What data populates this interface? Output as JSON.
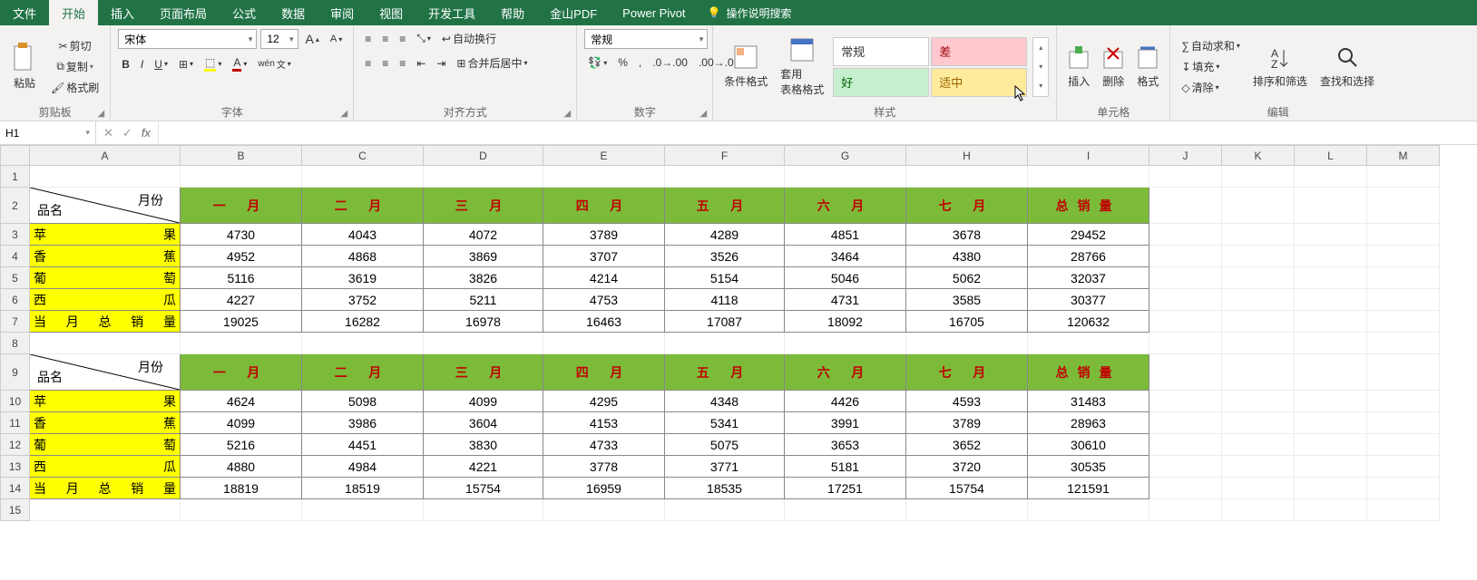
{
  "menu": {
    "tabs": [
      "文件",
      "开始",
      "插入",
      "页面布局",
      "公式",
      "数据",
      "审阅",
      "视图",
      "开发工具",
      "帮助",
      "金山PDF",
      "Power Pivot"
    ],
    "active": 1,
    "tell_me": "操作说明搜索"
  },
  "ribbon": {
    "clipboard": {
      "paste": "粘贴",
      "cut": "剪切",
      "copy": "复制",
      "format_painter": "格式刷",
      "label": "剪贴板"
    },
    "font": {
      "name": "宋体",
      "size": "12",
      "label": "字体"
    },
    "align": {
      "wrap": "自动换行",
      "merge": "合并后居中",
      "label": "对齐方式"
    },
    "number": {
      "format": "常规",
      "label": "数字"
    },
    "styles": {
      "cond": "条件格式",
      "table": "套用\n表格格式",
      "normal": "常规",
      "bad": "差",
      "good": "好",
      "neutral": "适中",
      "label": "样式"
    },
    "cells": {
      "insert": "插入",
      "delete": "删除",
      "format": "格式",
      "label": "单元格"
    },
    "editing": {
      "sum": "自动求和",
      "fill": "填充",
      "clear": "清除",
      "sort": "排序和筛选",
      "find": "查找和选择",
      "label": "编辑"
    }
  },
  "formula_bar": {
    "name": "H1",
    "value": ""
  },
  "columns": [
    "A",
    "B",
    "C",
    "D",
    "E",
    "F",
    "G",
    "H",
    "I",
    "J",
    "K",
    "L",
    "M"
  ],
  "diag": {
    "tr": "月份",
    "bl": "品名"
  },
  "months": [
    "一 月",
    "二 月",
    "三 月",
    "四 月",
    "五 月",
    "六 月",
    "七 月",
    "总销量"
  ],
  "block1": {
    "rows": [
      {
        "name": "苹果",
        "v": [
          4730,
          4043,
          4072,
          3789,
          4289,
          4851,
          3678,
          29452
        ]
      },
      {
        "name": "香蕉",
        "v": [
          4952,
          4868,
          3869,
          3707,
          3526,
          3464,
          4380,
          28766
        ]
      },
      {
        "name": "葡萄",
        "v": [
          5116,
          3619,
          3826,
          4214,
          5154,
          5046,
          5062,
          32037
        ]
      },
      {
        "name": "西瓜",
        "v": [
          4227,
          3752,
          5211,
          4753,
          4118,
          4731,
          3585,
          30377
        ]
      },
      {
        "name": "当月总销量",
        "v": [
          19025,
          16282,
          16978,
          16463,
          17087,
          18092,
          16705,
          120632
        ]
      }
    ]
  },
  "block2": {
    "rows": [
      {
        "name": "苹果",
        "v": [
          4624,
          5098,
          4099,
          4295,
          4348,
          4426,
          4593,
          31483
        ]
      },
      {
        "name": "香蕉",
        "v": [
          4099,
          3986,
          3604,
          4153,
          5341,
          3991,
          3789,
          28963
        ]
      },
      {
        "name": "葡萄",
        "v": [
          5216,
          4451,
          3830,
          4733,
          5075,
          3653,
          3652,
          30610
        ]
      },
      {
        "name": "西瓜",
        "v": [
          4880,
          4984,
          4221,
          3778,
          3771,
          5181,
          3720,
          30535
        ]
      },
      {
        "name": "当月总销量",
        "v": [
          18819,
          18519,
          15754,
          16959,
          18535,
          17251,
          15754,
          121591
        ]
      }
    ]
  },
  "chart_data": [
    {
      "type": "table",
      "title": "销量表1",
      "columns": [
        "一月",
        "二月",
        "三月",
        "四月",
        "五月",
        "六月",
        "七月",
        "总销量"
      ],
      "rows": [
        "苹果",
        "香蕉",
        "葡萄",
        "西瓜",
        "当月总销量"
      ],
      "values": [
        [
          4730,
          4043,
          4072,
          3789,
          4289,
          4851,
          3678,
          29452
        ],
        [
          4952,
          4868,
          3869,
          3707,
          3526,
          3464,
          4380,
          28766
        ],
        [
          5116,
          3619,
          3826,
          4214,
          5154,
          5046,
          5062,
          32037
        ],
        [
          4227,
          3752,
          5211,
          4753,
          4118,
          4731,
          3585,
          30377
        ],
        [
          19025,
          16282,
          16978,
          16463,
          17087,
          18092,
          16705,
          120632
        ]
      ]
    },
    {
      "type": "table",
      "title": "销量表2",
      "columns": [
        "一月",
        "二月",
        "三月",
        "四月",
        "五月",
        "六月",
        "七月",
        "总销量"
      ],
      "rows": [
        "苹果",
        "香蕉",
        "葡萄",
        "西瓜",
        "当月总销量"
      ],
      "values": [
        [
          4624,
          5098,
          4099,
          4295,
          4348,
          4426,
          4593,
          31483
        ],
        [
          4099,
          3986,
          3604,
          4153,
          5341,
          3991,
          3789,
          28963
        ],
        [
          5216,
          4451,
          3830,
          4733,
          5075,
          3653,
          3652,
          30610
        ],
        [
          4880,
          4984,
          4221,
          3778,
          3771,
          5181,
          3720,
          30535
        ],
        [
          18819,
          18519,
          15754,
          16959,
          18535,
          17251,
          15754,
          121591
        ]
      ]
    }
  ]
}
